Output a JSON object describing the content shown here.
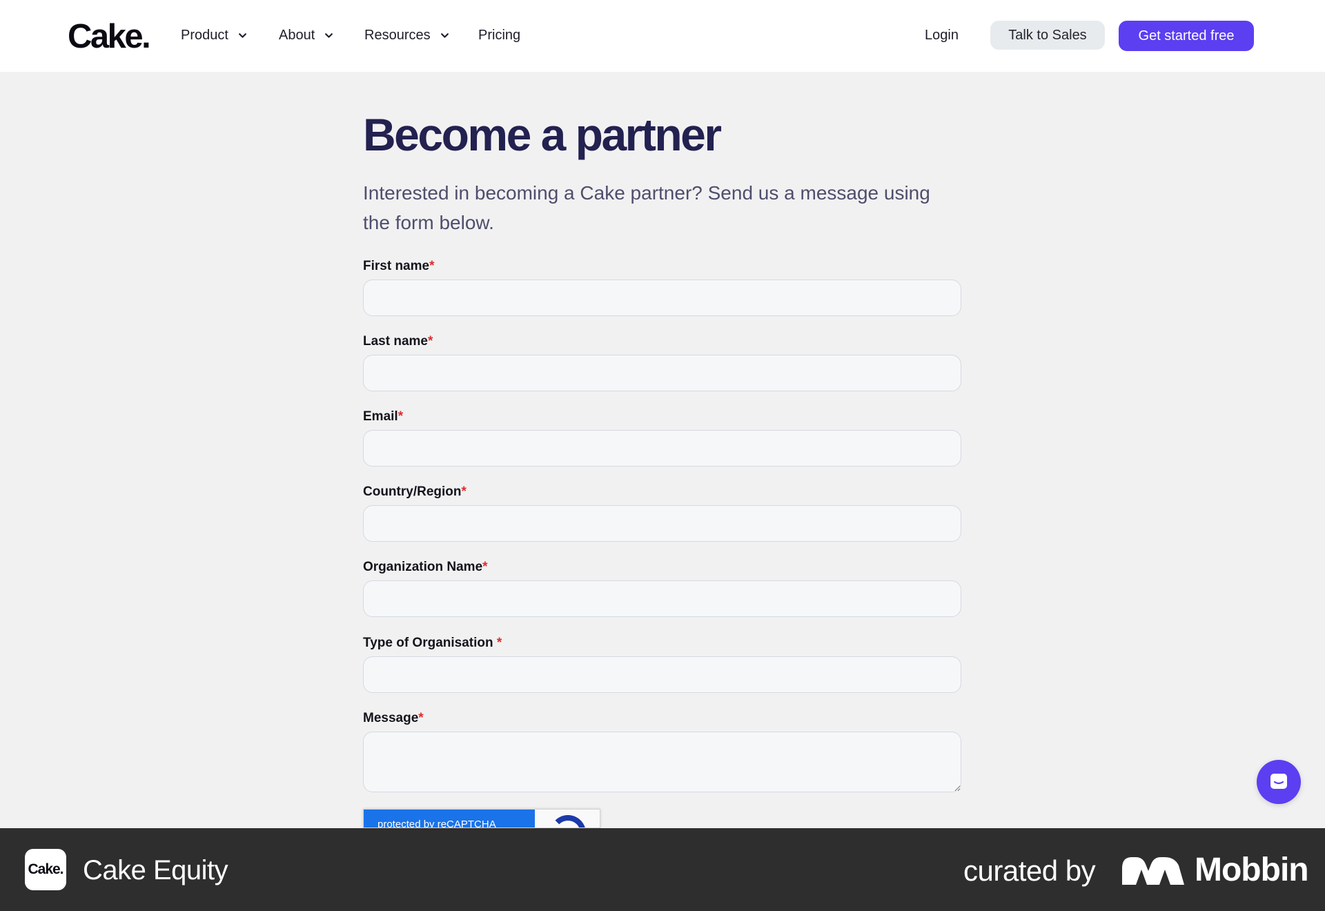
{
  "nav": {
    "logo": "Cake.",
    "items": [
      {
        "label": "Product",
        "has_dropdown": true
      },
      {
        "label": "About",
        "has_dropdown": true
      },
      {
        "label": "Resources",
        "has_dropdown": true
      },
      {
        "label": "Pricing",
        "has_dropdown": false
      }
    ],
    "login_label": "Login",
    "talk_to_sales_label": "Talk to Sales",
    "get_started_label": "Get started free"
  },
  "page": {
    "title": "Become a partner",
    "subtitle": "Interested in becoming a Cake partner? Send us a message using the form below."
  },
  "form": {
    "required_marker": "*",
    "fields": [
      {
        "label": "First name",
        "value": "",
        "placeholder": ""
      },
      {
        "label": "Last name",
        "value": "",
        "placeholder": ""
      },
      {
        "label": "Email",
        "value": "",
        "placeholder": ""
      },
      {
        "label": "Country/Region",
        "value": "",
        "placeholder": ""
      },
      {
        "label": "Organization Name",
        "value": "",
        "placeholder": ""
      },
      {
        "label": "Type of Organisation ",
        "value": "",
        "placeholder": ""
      },
      {
        "label": "Message",
        "value": "",
        "placeholder": ""
      }
    ],
    "captcha_text": "protected by reCAPTCHA"
  },
  "footer": {
    "app_logo_text": "Cake.",
    "app_name": "Cake Equity",
    "curated_by": "curated by",
    "brand": "Mobbin"
  },
  "colors": {
    "accent": "#5b3ff1",
    "title": "#232150",
    "required": "#e02b2b",
    "footer_bg": "#2e2e2f"
  },
  "icons": {
    "chevron": "chevron-down-icon",
    "chat": "chat-icon",
    "mobbin_mark": "mobbin-logo-icon"
  }
}
